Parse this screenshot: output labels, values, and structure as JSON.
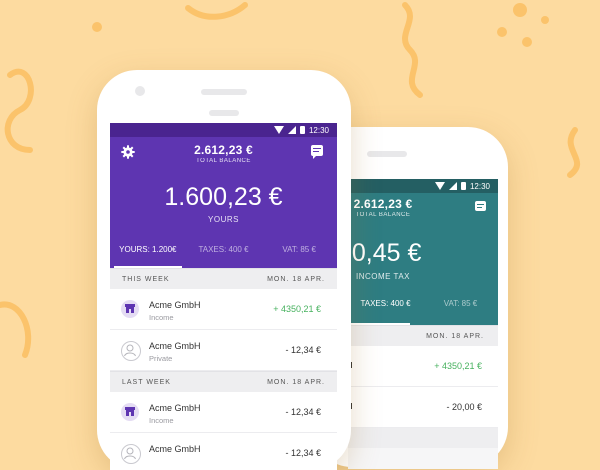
{
  "colors": {
    "background": "#fddba0",
    "decoration": "#fbc36b",
    "purple": "#5e35b1",
    "purple_dark": "#4a248f",
    "teal": "#2e7d82",
    "teal_dark": "#245f63",
    "positive": "#46b15e"
  },
  "front_phone": {
    "status_time": "12:30",
    "total_balance_value": "2.612,23 €",
    "total_balance_label": "TOTAL BALANCE",
    "main_value": "1.600,23 €",
    "main_label": "YOURS",
    "tabs": [
      {
        "label": "YOURS: 1.200€",
        "active": true
      },
      {
        "label": "TAXES: 400 €",
        "active": false
      },
      {
        "label": "VAT: 85 €",
        "active": false
      }
    ],
    "sections": [
      {
        "title": "THIS WEEK",
        "date": "MON. 18 APR."
      },
      {
        "title": "LAST WEEK",
        "date": "MON. 18 APR."
      }
    ],
    "transactions": [
      {
        "name": "Acme GmbH",
        "category": "Income",
        "amount": "+ 4350,21 €",
        "icon": "store-icon"
      },
      {
        "name": "Acme GmbH",
        "category": "Private",
        "amount": "- 12,34 €",
        "icon": "person-icon"
      },
      {
        "name": "Acme GmbH",
        "category": "Income",
        "amount": "- 12,34 €",
        "icon": "store-icon"
      },
      {
        "name": "Acme GmbH",
        "category": "",
        "amount": "- 12,34 €",
        "icon": "person-icon"
      }
    ],
    "icons": {
      "settings": "gear-icon",
      "chat": "chat-icon"
    }
  },
  "back_phone": {
    "status_time": "12:30",
    "total_balance_value": "2.612,23 €",
    "total_balance_label": "TOTAL BALANCE",
    "main_value": "00,45 €",
    "main_label": "INCOME TAX",
    "tabs": [
      {
        "label": "TAXES: 400 €",
        "active": true
      },
      {
        "label": "VAT: 85 €",
        "active": false
      }
    ],
    "section_date": "MON. 18 APR.",
    "amounts": [
      "+ 4350,21 €",
      "- 20,00 €"
    ],
    "icons": {
      "chat": "chat-icon"
    }
  }
}
